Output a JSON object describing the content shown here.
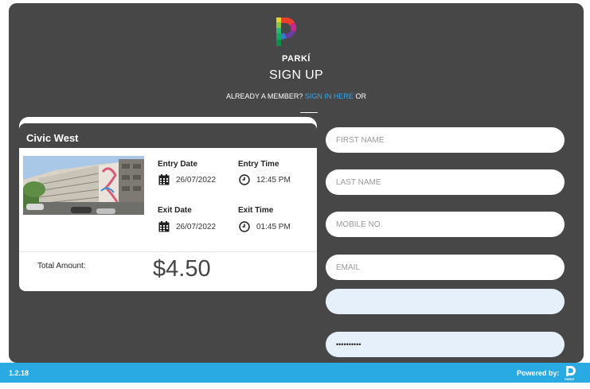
{
  "brand": {
    "name": "PARKÍ"
  },
  "header": {
    "title": "SIGN UP",
    "member_text": "ALREADY A MEMBER?",
    "sign_in_link": "SIGN IN HERE",
    "or_text": "OR"
  },
  "booking": {
    "location": "Civic West",
    "entry_date_label": "Entry Date",
    "entry_date": "26/07/2022",
    "entry_time_label": "Entry Time",
    "entry_time": "12:45 PM",
    "exit_date_label": "Exit Date",
    "exit_date": "26/07/2022",
    "exit_time_label": "Exit Time",
    "exit_time": "01:45 PM",
    "total_label": "Total Amount:",
    "total_amount": "$4.50"
  },
  "form": {
    "first_name_placeholder": "FIRST NAME",
    "last_name_placeholder": "LAST NAME",
    "mobile_placeholder": "MOBILE NO.",
    "email_placeholder": "EMAIL",
    "autofill_value": "",
    "password_value": "••••••••••"
  },
  "footer": {
    "version": "1.2.18",
    "powered_by": "Powered by:",
    "logo_text": "PARKÍ"
  },
  "colors": {
    "panel_bg": "#474747",
    "accent_link": "#3aa6e8",
    "footer_bg": "#2aaae2",
    "autofill_bg": "#e6f0fb"
  },
  "icons": {
    "calendar": "calendar-icon",
    "clock": "clock-icon",
    "logo": "parki-logo-icon"
  }
}
